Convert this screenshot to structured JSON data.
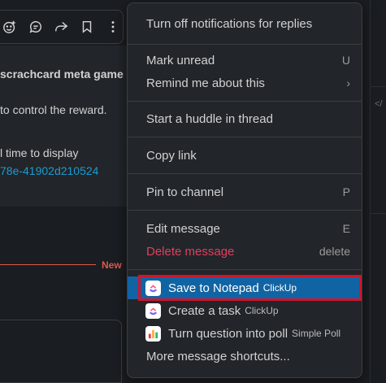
{
  "background": {
    "toolbar_icons": [
      "add-reaction-icon",
      "reply-in-thread-icon",
      "forward-icon",
      "bookmark-icon",
      "more-actions-icon"
    ],
    "message_title": "scrachcard meta game",
    "message_line1": "to control the reward.",
    "message_line2": "l time to display",
    "message_link": "78e-41902d210524",
    "new_label": "New",
    "right_code": "</"
  },
  "menu": {
    "top_item": "Turn off notifications for replies",
    "mark_unread": {
      "label": "Mark unread",
      "shortcut": "U"
    },
    "remind_me": {
      "label": "Remind me about this",
      "shortcut": "›"
    },
    "start_huddle": {
      "label": "Start a huddle in thread"
    },
    "copy_link": {
      "label": "Copy link"
    },
    "pin": {
      "label": "Pin to channel",
      "shortcut": "P"
    },
    "edit": {
      "label": "Edit message",
      "shortcut": "E"
    },
    "delete": {
      "label": "Delete message",
      "shortcut": "delete"
    },
    "save_notepad": {
      "label": "Save to Notepad",
      "app": "ClickUp",
      "icon": "clickup-icon"
    },
    "create_task": {
      "label": "Create a task",
      "app": "ClickUp",
      "icon": "clickup-icon"
    },
    "poll": {
      "label": "Turn question into poll",
      "app": "Simple Poll",
      "icon": "simple-poll-icon"
    },
    "more_shortcuts": {
      "label": "More message shortcuts..."
    }
  },
  "colors": {
    "background": "#1a1d21",
    "menu_bg": "#222529",
    "highlight": "#1164a3",
    "danger": "#e0405e",
    "link": "#1d9bd1",
    "new_divider": "#e0594b",
    "annotation_box": "#d0142b"
  }
}
